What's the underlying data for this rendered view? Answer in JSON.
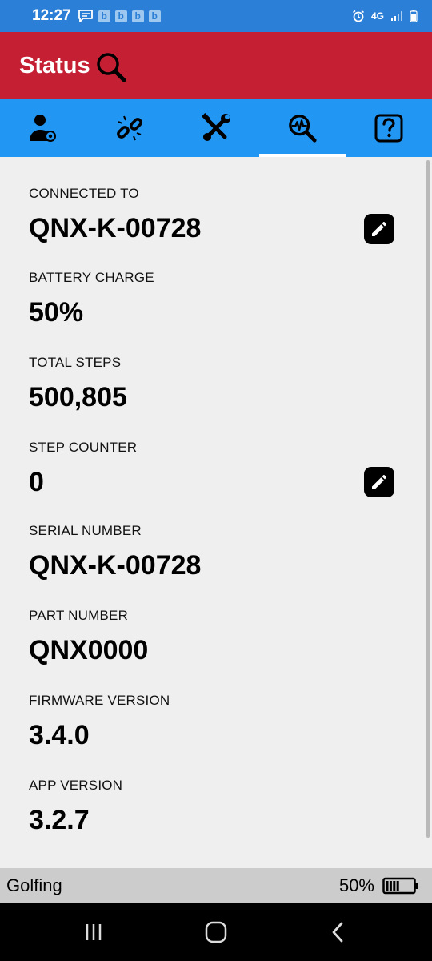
{
  "status_bar": {
    "time": "12:27",
    "notif_letter": "b",
    "network": "4G"
  },
  "app_bar": {
    "title": "Status"
  },
  "tabs": [
    {
      "name": "user-settings",
      "active": false
    },
    {
      "name": "connection",
      "active": false
    },
    {
      "name": "tools",
      "active": false
    },
    {
      "name": "status",
      "active": true
    },
    {
      "name": "help",
      "active": false
    }
  ],
  "fields": {
    "connected_to": {
      "label": "CONNECTED TO",
      "value": "QNX-K-00728"
    },
    "battery_charge": {
      "label": "BATTERY CHARGE",
      "value": "50%"
    },
    "total_steps": {
      "label": "TOTAL STEPS",
      "value": "500,805"
    },
    "step_counter": {
      "label": "STEP COUNTER",
      "value": "0"
    },
    "serial_number": {
      "label": "SERIAL NUMBER",
      "value": "QNX-K-00728"
    },
    "part_number": {
      "label": "PART NUMBER",
      "value": "QNX0000"
    },
    "firmware_version": {
      "label": "FIRMWARE VERSION",
      "value": "3.4.0"
    },
    "app_version": {
      "label": "APP VERSION",
      "value": "3.2.7"
    }
  },
  "bottom_bar": {
    "mode": "Golfing",
    "battery_percent": "50%",
    "battery_level": 0.5
  },
  "colors": {
    "status_bar": "#2b7fd6",
    "app_bar": "#c51f33",
    "tab_bar": "#2196f3",
    "background": "#efefef"
  }
}
